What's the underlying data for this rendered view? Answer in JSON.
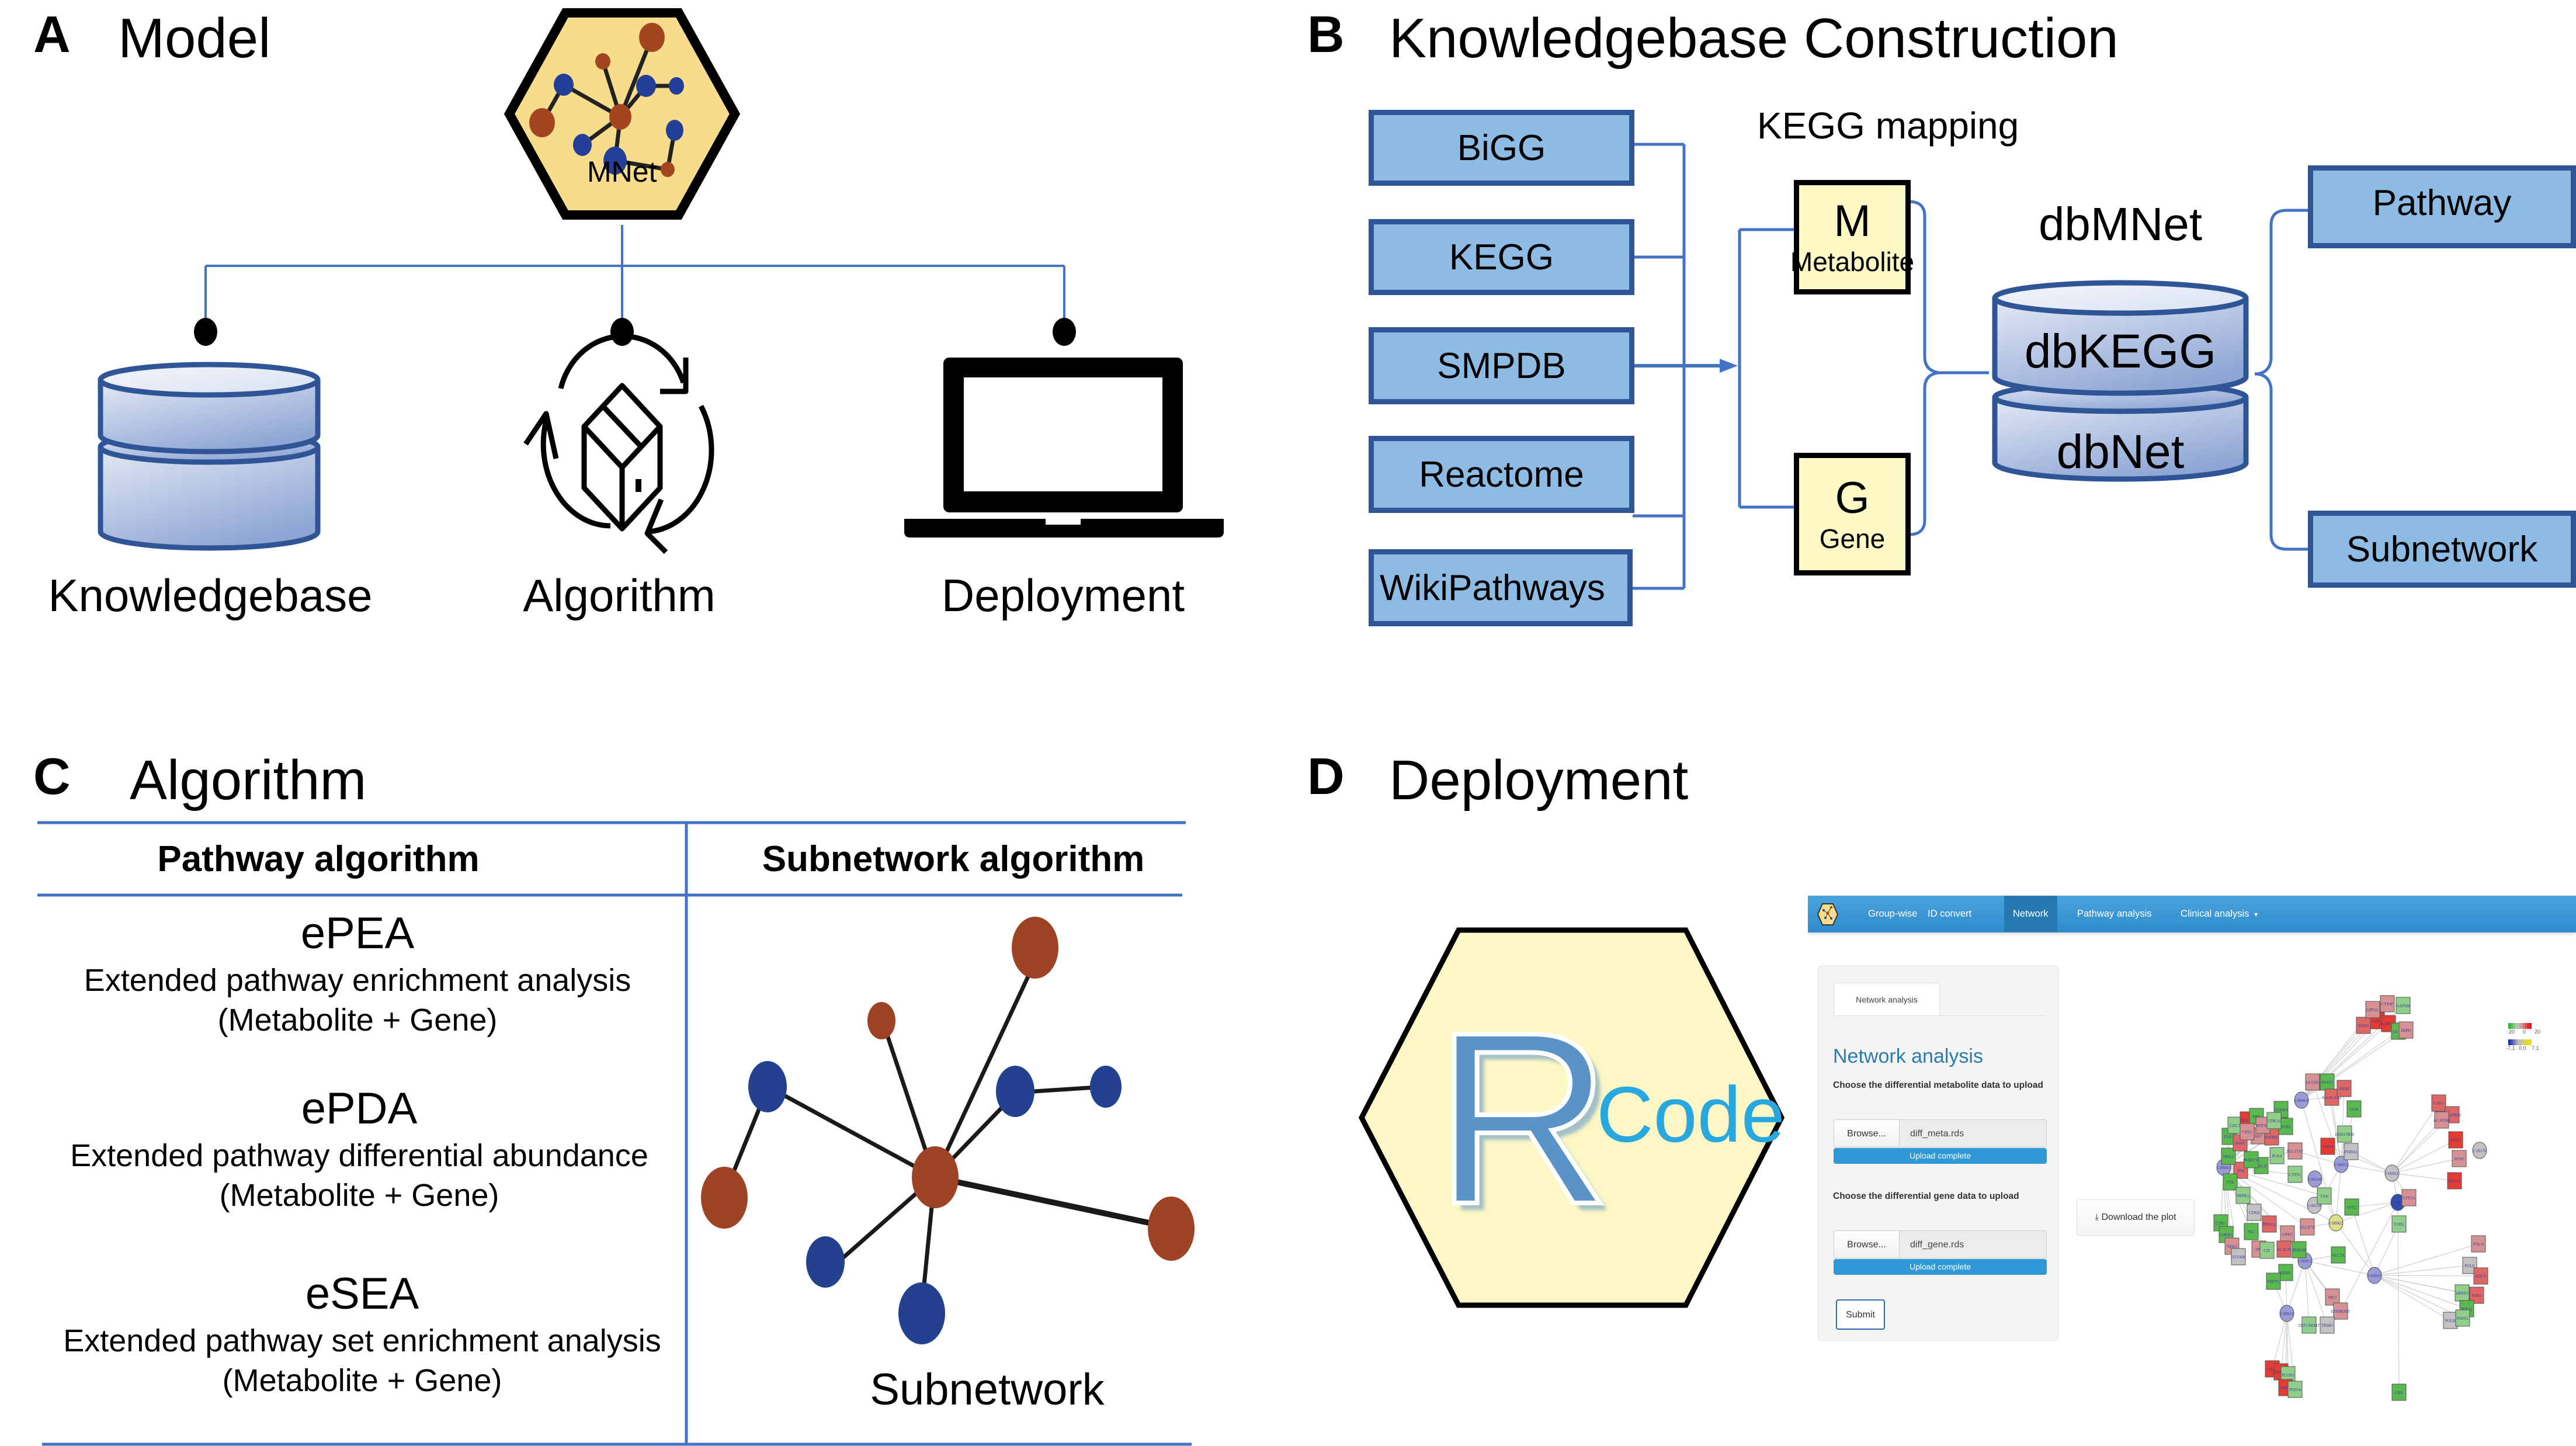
{
  "panels": {
    "A": {
      "letter": "A",
      "title": "Model",
      "logo_label": "MNet",
      "components": [
        {
          "label": "Knowledgebase",
          "icon": "database-icon"
        },
        {
          "label": "Algorithm",
          "icon": "cycle-box-icon"
        },
        {
          "label": "Deployment",
          "icon": "laptop-icon"
        }
      ]
    },
    "B": {
      "letter": "B",
      "title": "Knowledgebase Construction",
      "sources": [
        "BiGG",
        "KEGG",
        "SMPDB",
        "Reactome",
        "WikiPathways"
      ],
      "mapping_label": "KEGG mapping",
      "mapping_boxes": [
        {
          "letter": "M",
          "label": "Metabolite"
        },
        {
          "letter": "G",
          "label": "Gene"
        }
      ],
      "db_title": "dbMNet",
      "db_layers": [
        "dbKEGG",
        "dbNet"
      ],
      "outputs": [
        "Pathway",
        "Subnetwork"
      ],
      "colors": {
        "box_fill": "#8dbbe4",
        "box_border": "#2f5597",
        "map_fill": "#fdf8c4",
        "line": "#4472c4"
      }
    },
    "C": {
      "letter": "C",
      "title": "Algorithm",
      "headers": [
        "Pathway algorithm",
        "Subnetwork algorithm"
      ],
      "algorithms": [
        {
          "name": "ePEA",
          "desc": "Extended pathway enrichment analysis",
          "scope": "(Metabolite + Gene)"
        },
        {
          "name": "ePDA",
          "desc": "Extended pathway differential abundance",
          "scope": "(Metabolite + Gene)"
        },
        {
          "name": "eSEA",
          "desc": "Extended pathway set enrichment analysis",
          "scope": "(Metabolite + Gene)"
        }
      ],
      "subnetwork_label": "Subnetwork",
      "colors": {
        "metabolite_node": "#9e4325",
        "gene_node": "#24418f",
        "edge": "#1a1a1a"
      }
    },
    "D": {
      "letter": "D",
      "title": "Deployment",
      "r_logo": {
        "letter": "R",
        "word": "Code"
      },
      "app": {
        "nav_items": [
          "Group-wise",
          "ID convert",
          "Network",
          "Pathway analysis",
          "Clinical analysis"
        ],
        "active_nav": "Network",
        "dropdown_caret": "▾",
        "tab_label": "Network analysis",
        "heading": "Network analysis",
        "metabolite_prompt": "Choose the differential metabolite data to upload",
        "gene_prompt": "Choose the differential gene data to upload",
        "browse_label": "Browse...",
        "metabolite_file": "diff_meta.rds",
        "gene_file": "diff_gene.rds",
        "upload_status": "Upload complete",
        "upload_progress": 1.0,
        "submit_label": "Submit",
        "download_label": "Download the plot",
        "legend_gene": {
          "min": "-20",
          "mid": "0",
          "max": "20"
        },
        "legend_metabolite": {
          "min": "-7.1",
          "mid": "0.0",
          "max": "7.1"
        },
        "network_nodes": [
          {
            "label": "C00064",
            "kind": "met",
            "color": "lavender"
          },
          {
            "label": "C00025",
            "kind": "met",
            "color": "lavender"
          },
          {
            "label": "C00022",
            "kind": "met",
            "color": "grey"
          },
          {
            "label": "C00031",
            "kind": "met",
            "color": "lavender"
          },
          {
            "label": "C00013",
            "kind": "met",
            "color": "lavender"
          },
          {
            "label": "C00062",
            "kind": "met",
            "color": "yellow"
          },
          {
            "label": "C00073",
            "kind": "met",
            "color": "lavender"
          },
          {
            "label": "C00002",
            "kind": "met",
            "color": "lavender"
          },
          {
            "label": "C00039",
            "kind": "met",
            "color": "blue"
          },
          {
            "label": "C00249",
            "kind": "met",
            "color": "lavender"
          },
          {
            "label": "C18170",
            "kind": "met",
            "color": "grey"
          },
          {
            "label": "C00158",
            "kind": "met",
            "color": "grey"
          },
          {
            "label": "PLK1",
            "kind": "gene",
            "color": "green"
          },
          {
            "label": "CDC7",
            "kind": "gene",
            "color": "lightgreen"
          },
          {
            "label": "DCLK1",
            "kind": "gene",
            "color": "red"
          },
          {
            "label": "PBK",
            "kind": "gene",
            "color": "green"
          },
          {
            "label": "AURKA",
            "kind": "gene",
            "color": "green"
          },
          {
            "label": "BUB1",
            "kind": "gene",
            "color": "green"
          },
          {
            "label": "PLK4",
            "kind": "gene",
            "color": "lightgreen"
          },
          {
            "label": "MELK",
            "kind": "gene",
            "color": "green"
          },
          {
            "label": "TEK",
            "kind": "gene",
            "color": "salmon"
          },
          {
            "label": "TTK",
            "kind": "gene",
            "color": "green"
          },
          {
            "label": "NEK2",
            "kind": "gene",
            "color": "green"
          },
          {
            "label": "CDK1",
            "kind": "gene",
            "color": "green"
          },
          {
            "label": "CHEK1",
            "kind": "gene",
            "color": "green"
          },
          {
            "label": "NEK5",
            "kind": "gene",
            "color": "pink"
          },
          {
            "label": "TK1",
            "kind": "gene",
            "color": "green"
          },
          {
            "label": "TK2",
            "kind": "gene",
            "color": "pink"
          },
          {
            "label": "DTYMK",
            "kind": "gene",
            "color": "grey"
          },
          {
            "label": "CIT",
            "kind": "gene",
            "color": "lightgreen"
          },
          {
            "label": "GRK5",
            "kind": "gene",
            "color": "pink"
          },
          {
            "label": "BUB1B",
            "kind": "gene",
            "color": "green"
          },
          {
            "label": "PKMYT1",
            "kind": "gene",
            "color": "green"
          },
          {
            "label": "CDK8",
            "kind": "gene",
            "color": "grey"
          },
          {
            "label": "BMX",
            "kind": "gene",
            "color": "salmon"
          },
          {
            "label": "AK7",
            "kind": "gene",
            "color": "pink"
          },
          {
            "label": "TGFBR2",
            "kind": "gene",
            "color": "salmon"
          },
          {
            "label": "CPS1",
            "kind": "gene",
            "color": "pink"
          },
          {
            "label": "ATP2B1",
            "kind": "gene",
            "color": "pink"
          },
          {
            "label": "CDK16",
            "kind": "gene",
            "color": "lightgreen"
          },
          {
            "label": "SRPK1",
            "kind": "gene",
            "color": "lightgreen"
          },
          {
            "label": "PRKG1",
            "kind": "gene",
            "color": "salmon"
          },
          {
            "label": "RRM2",
            "kind": "gene",
            "color": "green"
          },
          {
            "label": "PNPT1",
            "kind": "gene",
            "color": "green"
          },
          {
            "label": "GLUD1",
            "kind": "gene",
            "color": "pink"
          },
          {
            "label": "PSAT1",
            "kind": "gene",
            "color": "green"
          },
          {
            "label": "NAALAD2",
            "kind": "gene",
            "color": "salmon"
          },
          {
            "label": "ABAT",
            "kind": "gene",
            "color": "salmon"
          },
          {
            "label": "GGH",
            "kind": "gene",
            "color": "green"
          },
          {
            "label": "HSD17B10",
            "kind": "gene",
            "color": "lightgreen"
          },
          {
            "label": "SLC17A7",
            "kind": "gene",
            "color": "pink"
          },
          {
            "label": "CTPS1",
            "kind": "gene",
            "color": "lightgreen"
          },
          {
            "label": "PDK4",
            "kind": "gene",
            "color": "red"
          },
          {
            "label": "PDHA1",
            "kind": "gene",
            "color": "grey"
          },
          {
            "label": "TXN",
            "kind": "gene",
            "color": "lightgreen"
          },
          {
            "label": "GPT2",
            "kind": "gene",
            "color": "green"
          },
          {
            "label": "SLC27A",
            "kind": "gene",
            "color": "pink"
          },
          {
            "label": "ACACB",
            "kind": "gene",
            "color": "salmon"
          },
          {
            "label": "SLC7A",
            "kind": "gene",
            "color": "green"
          },
          {
            "label": "ME3",
            "kind": "gene",
            "color": "pink"
          },
          {
            "label": "ETFBKMT",
            "kind": "gene",
            "color": "pink"
          },
          {
            "label": "EEF1AKMT",
            "kind": "gene",
            "color": "lightgreen"
          },
          {
            "label": "TRMO",
            "kind": "gene",
            "color": "grey"
          },
          {
            "label": "CAV1",
            "kind": "gene",
            "color": "salmon"
          },
          {
            "label": "NOSTRIN",
            "kind": "gene",
            "color": "salmon"
          },
          {
            "label": "ACADSB",
            "kind": "gene",
            "color": "pink"
          },
          {
            "label": "AOX1",
            "kind": "gene",
            "color": "red"
          },
          {
            "label": "NOS3",
            "kind": "gene",
            "color": "pink"
          },
          {
            "label": "MAOA",
            "kind": "gene",
            "color": "red"
          },
          {
            "label": "CPT1A",
            "kind": "gene",
            "color": "pink"
          },
          {
            "label": "YOD1",
            "kind": "gene",
            "color": "lightgreen"
          },
          {
            "label": "POLN",
            "kind": "gene",
            "color": "pink"
          },
          {
            "label": "POLE",
            "kind": "gene",
            "color": "grey"
          },
          {
            "label": "ADCY",
            "kind": "gene",
            "color": "salmon"
          },
          {
            "label": "NPR1",
            "kind": "gene",
            "color": "salmon"
          },
          {
            "label": "HPRT1",
            "kind": "gene",
            "color": "lightgreen"
          },
          {
            "label": "POLQ",
            "kind": "gene",
            "color": "green"
          },
          {
            "label": "POLK",
            "kind": "gene",
            "color": "grey"
          },
          {
            "label": "PDSS1",
            "kind": "gene",
            "color": "lightgreen"
          },
          {
            "label": "CBS",
            "kind": "gene",
            "color": "green"
          },
          {
            "label": "RDH5",
            "kind": "gene",
            "color": "salmon"
          },
          {
            "label": "GPD1",
            "kind": "gene",
            "color": "red"
          },
          {
            "label": "ALDH1A1",
            "kind": "gene",
            "color": "red"
          },
          {
            "label": "GLDC",
            "kind": "gene",
            "color": "green"
          },
          {
            "label": "H6PD",
            "kind": "gene",
            "color": "pink"
          },
          {
            "label": "GAPDH",
            "kind": "gene",
            "color": "lightgreen"
          },
          {
            "label": "CYP4F",
            "kind": "gene",
            "color": "pink"
          },
          {
            "label": "GPD1L",
            "kind": "gene",
            "color": "pink"
          },
          {
            "label": "OGN",
            "kind": "gene",
            "color": "red"
          },
          {
            "label": "GALNT5",
            "kind": "gene",
            "color": "red"
          },
          {
            "label": "PLOD1",
            "kind": "gene",
            "color": "lightgreen"
          },
          {
            "label": "FMO1",
            "kind": "gene",
            "color": "red"
          },
          {
            "label": "PDIA4",
            "kind": "gene",
            "color": "lightgreen"
          }
        ],
        "node_colors": {
          "lavender": "#9b9bd6",
          "blue": "#2f4fb0",
          "grey": "#c2c2c2",
          "yellow": "#e1e08a",
          "green": "#59b94f",
          "lightgreen": "#8fcf8a",
          "red": "#e43b33",
          "salmon": "#dc6766",
          "pink": "#d69293"
        }
      }
    }
  }
}
